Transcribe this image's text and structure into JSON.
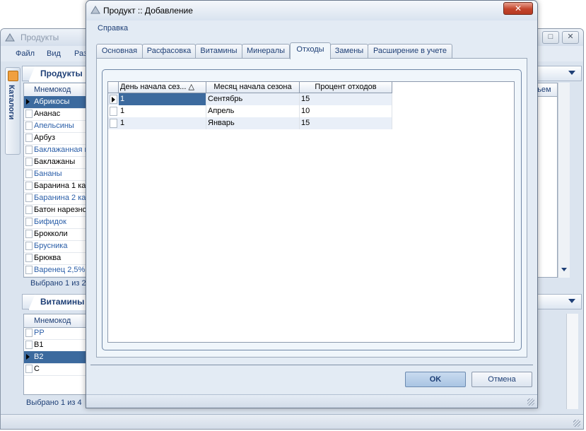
{
  "main_window": {
    "title": "Продукты",
    "menu": [
      "Файл",
      "Вид",
      "Раз"
    ],
    "side_label": "Каталоги",
    "products_panel": {
      "tab": "Продукты",
      "column": "Мнемокод",
      "right_column_fragment": "ъем",
      "items": [
        "Абрикосы",
        "Ананас",
        "Апельсины",
        "Арбуз",
        "Баклажанная к",
        "Баклажаны",
        "Бананы",
        "Баранина 1 кат",
        "Баранина 2 кат",
        "Батон нарезно",
        "Бифидок",
        "Брокколи",
        "Брусника",
        "Брюква",
        "Варенец 2,5%"
      ],
      "selected_index": 0,
      "status": "Выбрано 1 из 2"
    },
    "vitamins_panel": {
      "tab": "Витамины",
      "column": "Мнемокод",
      "items": [
        "PP",
        "B1",
        "B2",
        "C"
      ],
      "selected_index": 2,
      "status": "Выбрано 1 из 4"
    }
  },
  "dialog": {
    "title": "Продукт :: Добавление",
    "close_label": "✕",
    "menu_help": "Справка",
    "tabs": [
      "Основная",
      "Расфасовка",
      "Витамины",
      "Минералы",
      "Отходы",
      "Замены",
      "Расширение в учете"
    ],
    "active_tab": 4,
    "grid": {
      "columns": [
        "День начала сез... △",
        "Месяц начала сезона",
        "Процент отходов"
      ],
      "rows": [
        [
          "1",
          "Сентябрь",
          "15"
        ],
        [
          "1",
          "Апрель",
          "10"
        ],
        [
          "1",
          "Январь",
          "15"
        ]
      ],
      "selected_row": 0
    },
    "ok_label": "OK",
    "cancel_label": "Отмена"
  },
  "colors": {
    "selection": "#3c6a9e",
    "accent_text": "#1e3f76",
    "close_button": "#c3442b"
  }
}
